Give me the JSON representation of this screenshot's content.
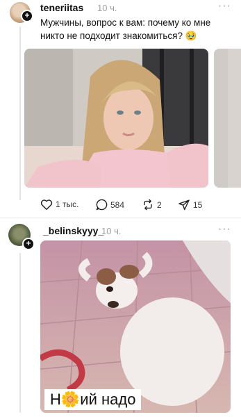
{
  "posts": [
    {
      "username": "teneriitas",
      "time": "10 ч.",
      "text": "Мужчины, вопрос к вам: почему ко мне никто не подходит знакомиться? 🥹",
      "actions": {
        "likes": "1 тыс.",
        "comments": "584",
        "reposts": "2",
        "shares": "15"
      },
      "icons": [
        "heart-icon",
        "comment-icon",
        "repost-icon",
        "send-icon"
      ]
    },
    {
      "username": "_belinskyyy_",
      "time": "10 ч.",
      "caption": "Н🌼ий надо"
    }
  ],
  "more_label": "···",
  "follow_label": "+"
}
